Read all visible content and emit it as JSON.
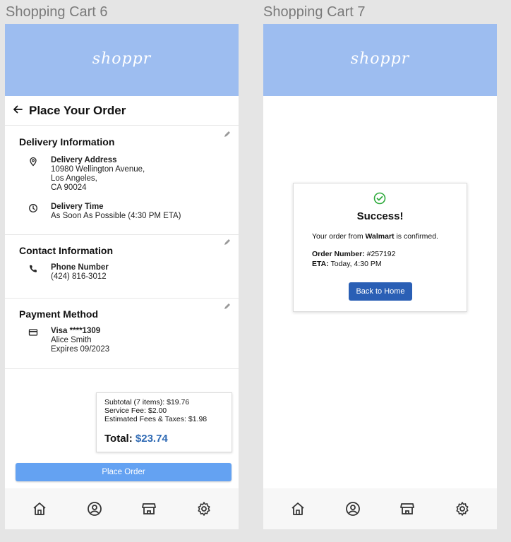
{
  "frames": [
    {
      "title": "Shopping Cart 6"
    },
    {
      "title": "Shopping Cart 7"
    }
  ],
  "brand": {
    "logo": "shoppr",
    "header_color": "#9dbdf0",
    "accent": "#2f6ab4"
  },
  "place_order": {
    "back_icon": "back-arrow-icon",
    "title": "Place Your Order",
    "delivery": {
      "title": "Delivery Information",
      "address_label": "Delivery Address",
      "address": "10980 Wellington Avenue,\nLos Angeles,\nCA 90024",
      "time_label": "Delivery Time",
      "time": "As Soon As Possible (4:30 PM ETA)"
    },
    "contact": {
      "title": "Contact Information",
      "phone_label": "Phone Number",
      "phone": "(424) 816-3012"
    },
    "payment": {
      "title": "Payment Method",
      "card": "Visa ****1309",
      "name": "Alice Smith",
      "expires": "Expires 09/2023"
    },
    "summary": {
      "subtotal": "Subtotal (7 items): $19.76",
      "service_fee": "Service Fee: $2.00",
      "fees_taxes": "Estimated Fees & Taxes: $1.98",
      "total_label": "Total:",
      "total_value": "$23.74"
    },
    "button": "Place Order"
  },
  "success": {
    "title": "Success!",
    "confirm_prefix": "Your order from ",
    "store": "Walmart",
    "confirm_suffix": " is confirmed.",
    "order_label": "Order Number:",
    "order_value": " #257192",
    "eta_label": "ETA:",
    "eta_value": " Today, 4:30 PM",
    "button": "Back to Home"
  },
  "nav": [
    "home-icon",
    "profile-icon",
    "store-icon",
    "settings-icon"
  ]
}
